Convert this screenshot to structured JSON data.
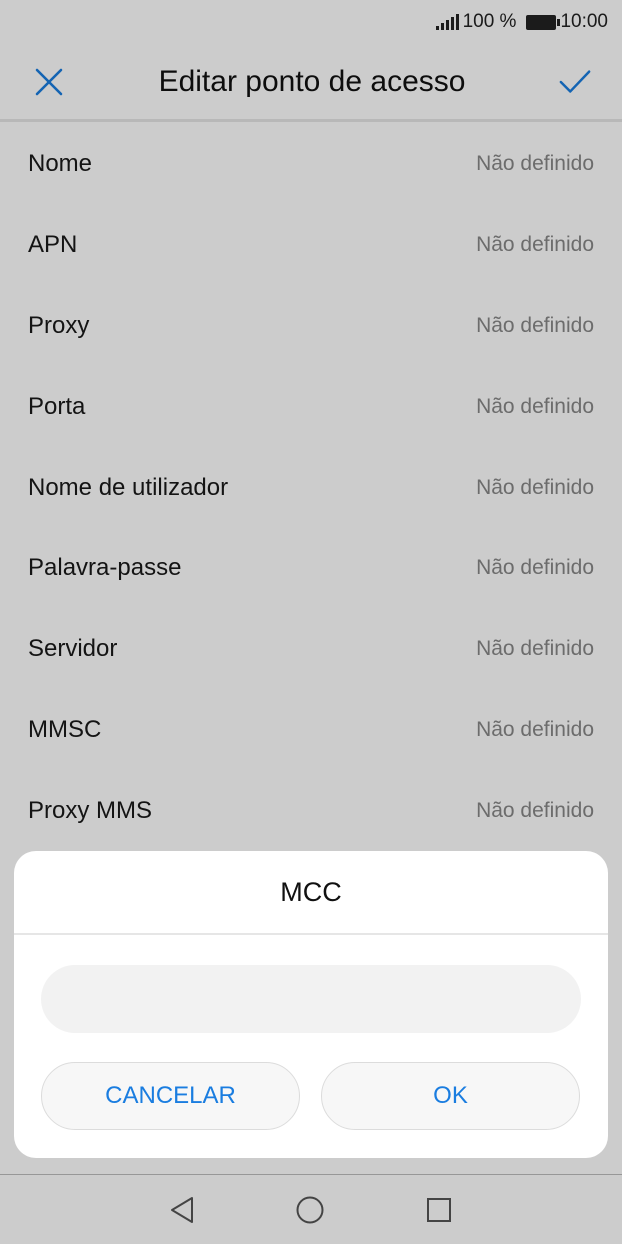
{
  "status_bar": {
    "battery": "100 %",
    "time": "10:00"
  },
  "header": {
    "title": "Editar ponto de acesso",
    "close_icon": "close-icon",
    "confirm_icon": "check-icon",
    "accent_color": "#1a7de0"
  },
  "settings": [
    {
      "label": "Nome",
      "value": "Não definido"
    },
    {
      "label": "APN",
      "value": "Não definido"
    },
    {
      "label": "Proxy",
      "value": "Não definido"
    },
    {
      "label": "Porta",
      "value": "Não definido"
    },
    {
      "label": "Nome de utilizador",
      "value": "Não definido"
    },
    {
      "label": "Palavra-passe",
      "value": "Não definido"
    },
    {
      "label": "Servidor",
      "value": "Não definido"
    },
    {
      "label": "MMSC",
      "value": "Não definido"
    },
    {
      "label": "Proxy MMS",
      "value": "Não definido"
    }
  ],
  "dialog": {
    "title": "MCC",
    "input_value": "",
    "cancel_label": "CANCELAR",
    "ok_label": "OK"
  },
  "nav_bar": {
    "back_icon": "back-icon",
    "home_icon": "home-icon",
    "recents_icon": "recents-icon"
  }
}
